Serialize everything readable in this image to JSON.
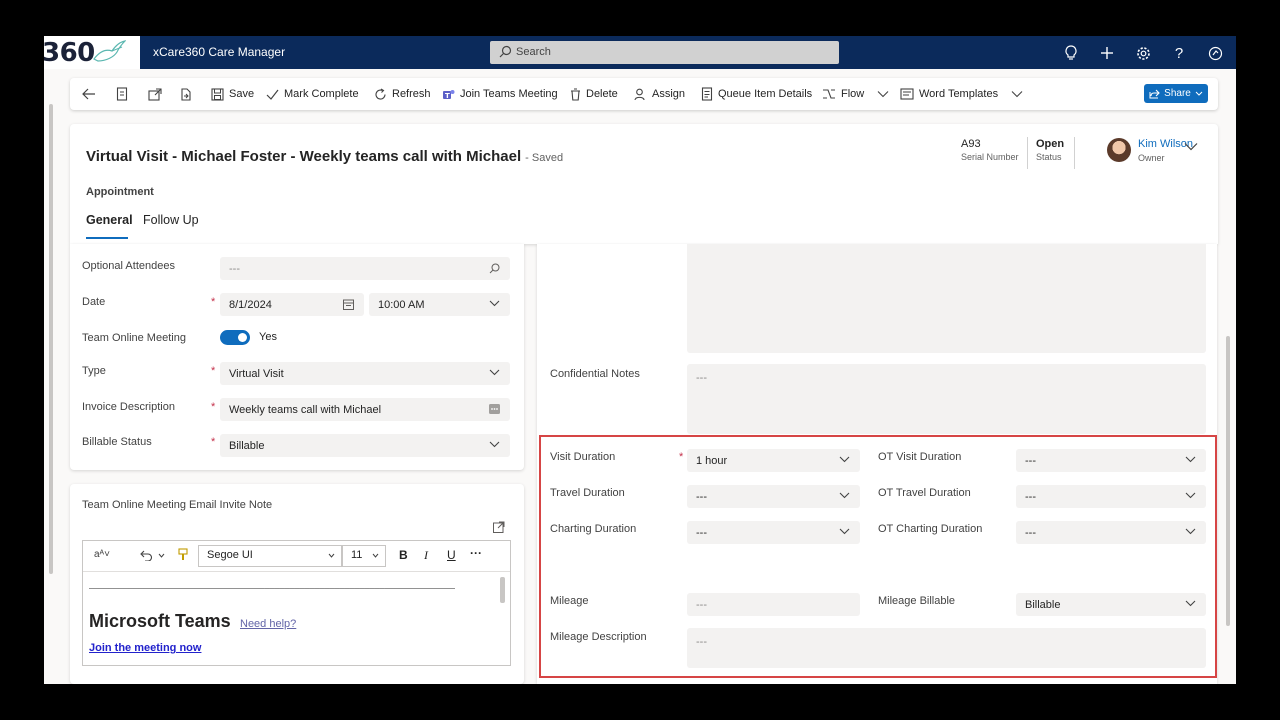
{
  "topbar": {
    "logo_text": "360",
    "app_title": "xCare360 Care Manager",
    "search_placeholder": "Search"
  },
  "commands": {
    "save": "Save",
    "mark_complete": "Mark Complete",
    "refresh": "Refresh",
    "join_teams": "Join Teams Meeting",
    "delete": "Delete",
    "assign": "Assign",
    "queue_item": "Queue Item Details",
    "flow": "Flow",
    "word_templates": "Word Templates",
    "share": "Share"
  },
  "header": {
    "title": "Virtual Visit - Michael Foster - Weekly teams call with Michael",
    "saved": "- Saved",
    "entity": "Appointment",
    "tabs": [
      "General",
      "Follow Up"
    ],
    "serial_value": "A93",
    "serial_label": "Serial Number",
    "status_value": "Open",
    "status_label": "Status",
    "owner_name": "Kim Wilson",
    "owner_label": "Owner"
  },
  "left_form": {
    "optional_attendees": {
      "label": "Optional Attendees",
      "value": "---"
    },
    "date": {
      "label": "Date",
      "date": "8/1/2024",
      "time": "10:00 AM"
    },
    "team_online": {
      "label": "Team Online Meeting",
      "value": "Yes"
    },
    "type": {
      "label": "Type",
      "value": "Virtual Visit"
    },
    "invoice": {
      "label": "Invoice Description",
      "value": "Weekly teams call with Michael"
    },
    "billable": {
      "label": "Billable Status",
      "value": "Billable"
    }
  },
  "invite": {
    "label": "Team Online Meeting Email Invite Note",
    "font": "Segoe UI",
    "size": "11",
    "rule": "________________________________________________________________________________",
    "heading": "Microsoft Teams",
    "help": "Need help?",
    "join": "Join the meeting now"
  },
  "right_form": {
    "confidential": {
      "label": "Confidential Notes",
      "value": "---"
    },
    "visit_duration": {
      "label": "Visit Duration",
      "value": "1 hour"
    },
    "ot_visit": {
      "label": "OT Visit Duration",
      "value": "---"
    },
    "travel": {
      "label": "Travel Duration",
      "value": "---"
    },
    "ot_travel": {
      "label": "OT Travel Duration",
      "value": "---"
    },
    "charting": {
      "label": "Charting Duration",
      "value": "---"
    },
    "ot_charting": {
      "label": "OT Charting Duration",
      "value": "---"
    },
    "mileage": {
      "label": "Mileage",
      "value": "---"
    },
    "mileage_billable": {
      "label": "Mileage Billable",
      "value": "Billable"
    },
    "mileage_desc": {
      "label": "Mileage Description",
      "value": "---"
    }
  },
  "colors": {
    "nav": "#0b2a5b",
    "accent": "#0f6cbd",
    "highlight": "#d64545"
  }
}
